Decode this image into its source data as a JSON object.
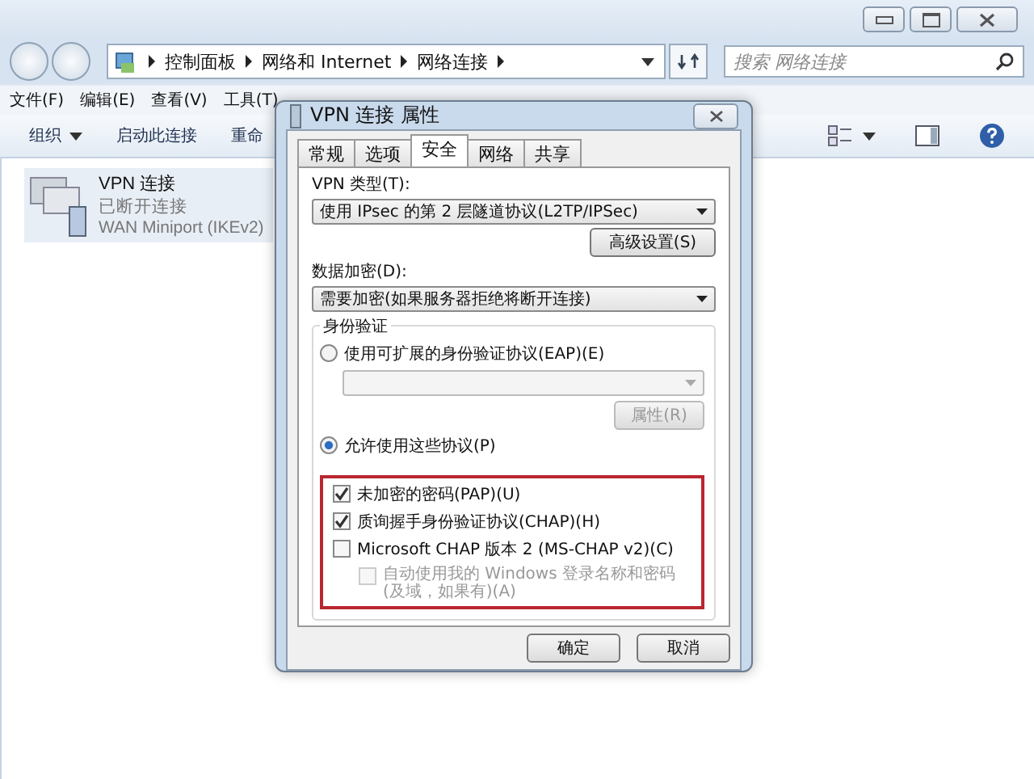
{
  "explorer": {
    "breadcrumbs": [
      "控制面板",
      "网络和 Internet",
      "网络连接"
    ],
    "search": {
      "placeholder": "搜索 网络连接"
    },
    "menu": [
      "文件(F)",
      "编辑(E)",
      "查看(V)",
      "工具(T)"
    ],
    "toolbar": [
      {
        "label": "组织",
        "dropdown": true
      },
      {
        "label": "启动此连接",
        "dropdown": false
      },
      {
        "label": "重命",
        "dropdown": false
      }
    ],
    "items": [
      {
        "name": "VPN 连接",
        "status": "已断开连接",
        "device": "WAN Miniport (IKEv2)",
        "selected": true
      }
    ]
  },
  "dialog": {
    "title": "VPN 连接 属性",
    "tabs": [
      {
        "label": "常规",
        "selected": false
      },
      {
        "label": "选项",
        "selected": false
      },
      {
        "label": "安全",
        "selected": true
      },
      {
        "label": "网络",
        "selected": false
      },
      {
        "label": "共享",
        "selected": false
      }
    ],
    "vpn_type": {
      "label": "VPN 类型(T):",
      "value": "使用 IPsec 的第 2 层隧道协议(L2TP/IPSec)"
    },
    "advanced_button": "高级设置(S)",
    "encryption": {
      "label": "数据加密(D):",
      "value": "需要加密(如果服务器拒绝将断开连接)"
    },
    "auth": {
      "title": "身份验证",
      "eap": {
        "label": "使用可扩展的身份验证协议(EAP)(E)",
        "selected": false,
        "properties_button": "属性(R)"
      },
      "allow": {
        "label": "允许使用这些协议(P)",
        "selected": true
      },
      "highlighted": true,
      "protocols": [
        {
          "label": "未加密的密码(PAP)(U)",
          "checked": true,
          "disabled": false
        },
        {
          "label": "质询握手身份验证协议(CHAP)(H)",
          "checked": true,
          "disabled": false
        },
        {
          "label": "Microsoft CHAP 版本 2 (MS-CHAP v2)(C)",
          "checked": false,
          "disabled": false,
          "children": [
            {
              "label": "自动使用我的 Windows 登录名称和密码(及域，如果有)(A)",
              "checked": false,
              "disabled": true
            }
          ]
        }
      ]
    },
    "buttons": [
      "确定",
      "取消"
    ]
  }
}
